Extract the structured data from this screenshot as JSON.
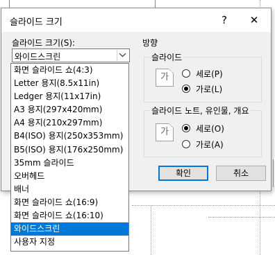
{
  "dialog": {
    "title": "슬라이드 크기",
    "help_glyph": "?",
    "close_glyph": "✕"
  },
  "size": {
    "label": "슬라이드 크기(S):",
    "current": "와이드스크린",
    "options": [
      "화면 슬라이드 쇼(4:3)",
      "Letter 용지(8.5x11in)",
      "Ledger 용지(11x17in)",
      "A3 용지(297x420mm)",
      "A4 용지(210x297mm)",
      "B4(ISO) 용지(250x353mm)",
      "B5(ISO) 용지(176x250mm)",
      "35mm 슬라이드",
      "오버헤드",
      "배너",
      "화면 슬라이드 쇼(16:9)",
      "화면 슬라이드 쇼(16:10)",
      "와이드스크린",
      "사용자 지정"
    ],
    "selected_index": 12
  },
  "orientation": {
    "label": "방향",
    "slides": {
      "label": "슬라이드",
      "glyph": "가",
      "portrait": "세로(P)",
      "landscape": "가로(L)",
      "selected": "landscape"
    },
    "notes": {
      "label": "슬라이드 노트, 유인물, 개요",
      "glyph": "가",
      "portrait": "세로(O)",
      "landscape": "가로(A)",
      "selected": "portrait"
    }
  },
  "buttons": {
    "ok": "확인",
    "cancel": "취소"
  }
}
